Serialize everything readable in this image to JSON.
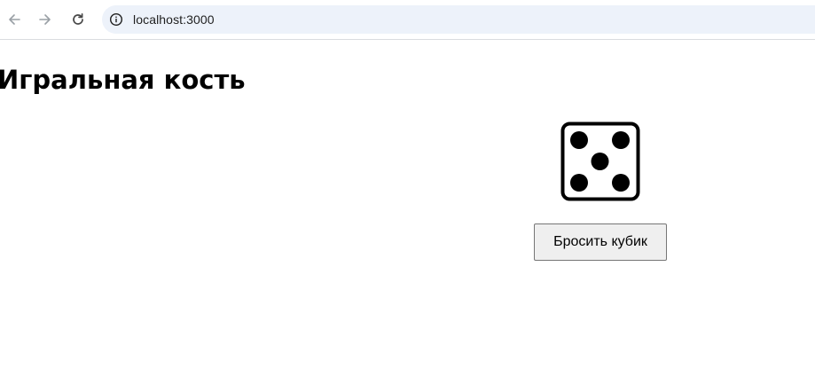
{
  "browser": {
    "url": "localhost:3000",
    "icons": {
      "back": "arrow-left-icon",
      "forward": "arrow-right-icon",
      "reload": "reload-icon",
      "site_info": "info-icon"
    },
    "colors": {
      "omnibox_bg": "#edf2fa",
      "nav_icon_disabled": "#9aa0a6",
      "nav_icon_active": "#474747"
    }
  },
  "page": {
    "title": "Игральная кость",
    "die": {
      "value": 5,
      "icon": "dice-five-icon",
      "color": "#000000"
    },
    "roll_button_label": "Бросить кубик"
  }
}
